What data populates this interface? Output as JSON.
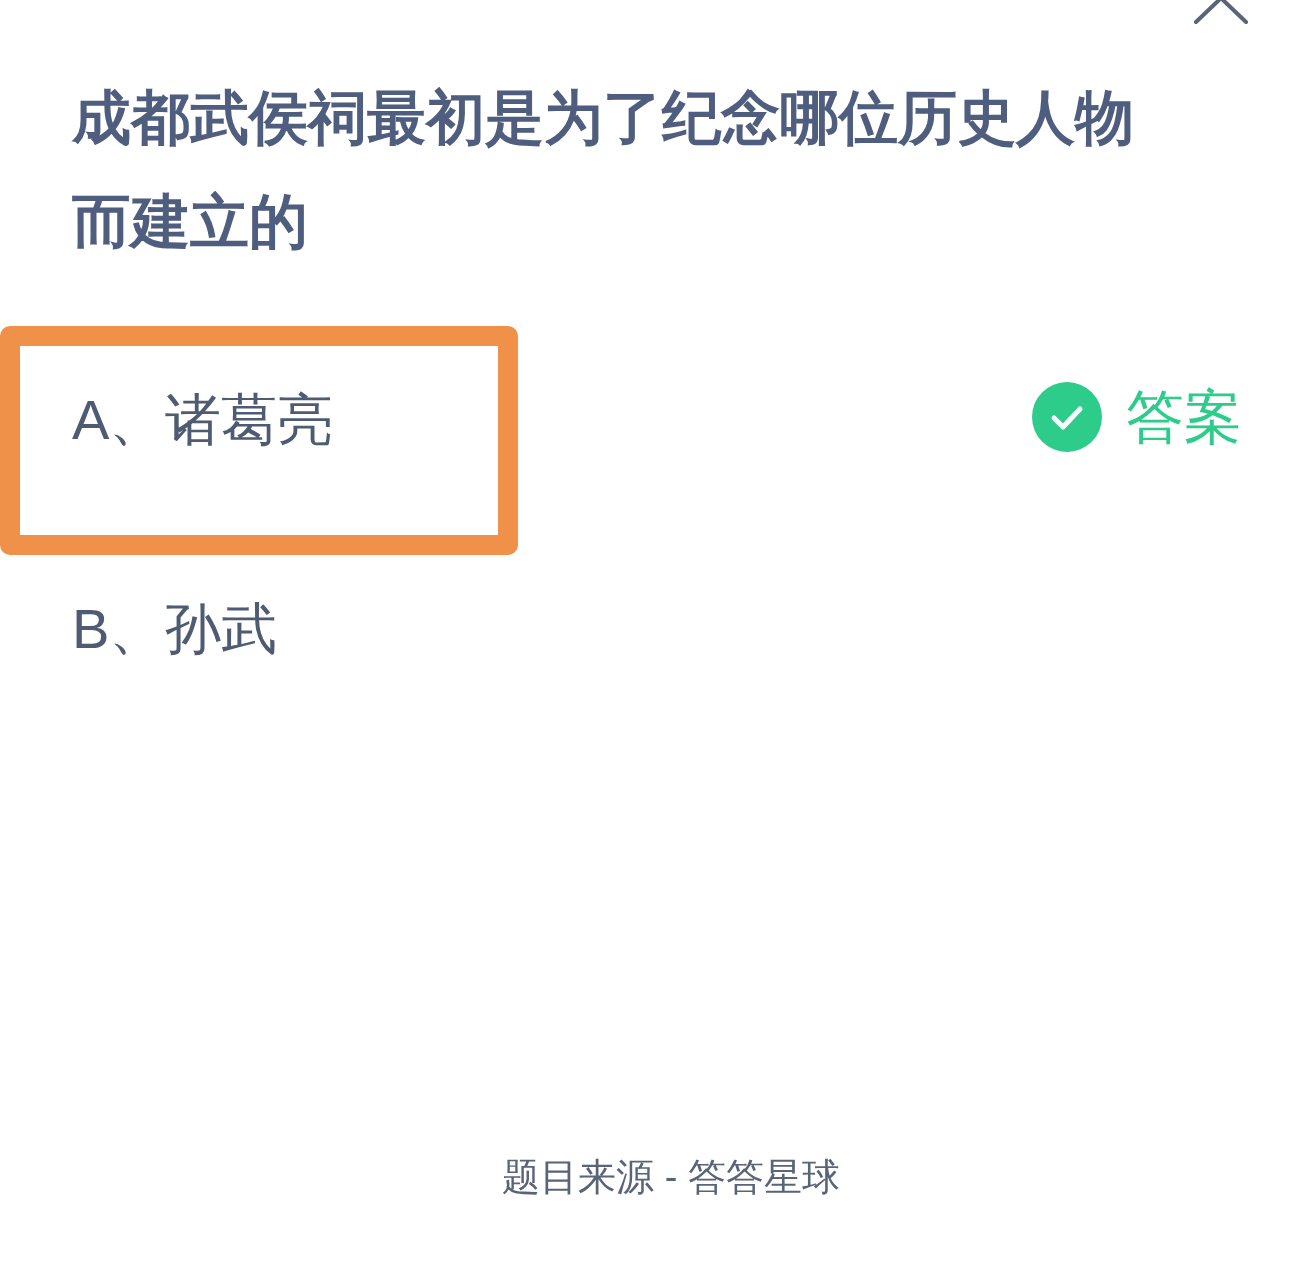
{
  "question": "成都武侯祠最初是为了纪念哪位历史人物而建立的",
  "options": [
    {
      "label": "A、诸葛亮",
      "highlighted": true,
      "correct": true,
      "answer_label": "答案"
    },
    {
      "label": "B、孙武",
      "highlighted": false,
      "correct": false
    }
  ],
  "footer": "题目来源 - 答答星球"
}
